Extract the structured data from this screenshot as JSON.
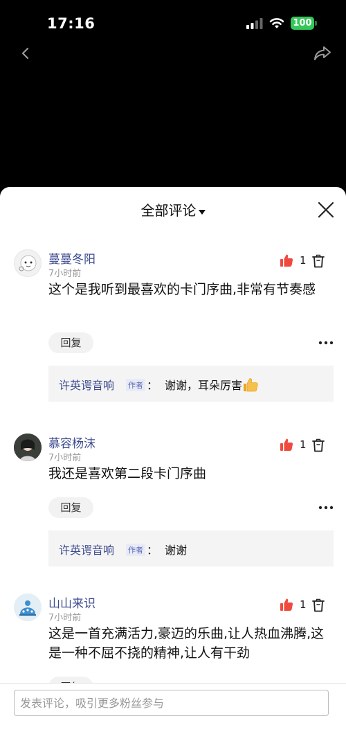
{
  "status_bar": {
    "time": "17:16",
    "battery": "100"
  },
  "sheet": {
    "title": "全部评论"
  },
  "comments": [
    {
      "username": "蔓蔓冬阳",
      "time": "7小时前",
      "likes": "1",
      "text": "这个是我听到最喜欢的卡门序曲,非常有节奏感",
      "reply_label": "回复",
      "reply": {
        "author": "许英谔音响",
        "badge": "作者",
        "colon": "：",
        "text": "谢谢，耳朵厉害"
      }
    },
    {
      "username": "慕容杨沫",
      "time": "7小时前",
      "likes": "1",
      "text": "我还是喜欢第二段卡门序曲",
      "reply_label": "回复",
      "reply": {
        "author": "许英谔音响",
        "badge": "作者",
        "colon": "：",
        "text": "谢谢"
      }
    },
    {
      "username": "山山来识",
      "time": "7小时前",
      "likes": "1",
      "text": "这是一首充满活力,豪迈的乐曲,让人热血沸腾,这是一种不屈不挠的精神,让人有干劲",
      "reply_label": "回复"
    }
  ],
  "input": {
    "placeholder": "发表评论，吸引更多粉丝参与"
  },
  "colors": {
    "like": "#f04a3e",
    "username": "#3d4b8f",
    "battery": "#34c759"
  },
  "icons": [
    "back-icon",
    "share-icon",
    "close-icon",
    "thumb-up-icon",
    "delete-icon",
    "more-icon",
    "caret-down-icon"
  ]
}
